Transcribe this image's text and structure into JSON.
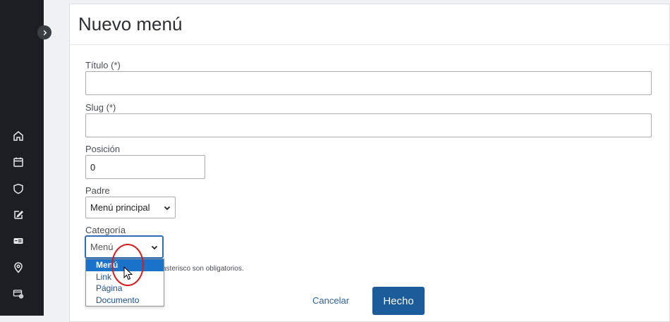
{
  "page": {
    "title": "Nuevo menú"
  },
  "form": {
    "titulo_label": "Título (*)",
    "titulo_value": "",
    "slug_label": "Slug (*)",
    "slug_value": "",
    "posicion_label": "Posición",
    "posicion_value": "0",
    "padre_label": "Padre",
    "padre_value": "Menú principal",
    "categoria_label": "Categoría",
    "categoria_value": "Menú",
    "categoria_options": [
      "Menú",
      "Link",
      "Página",
      "Documento"
    ],
    "required_note": "asterisco son obligatorios."
  },
  "actions": {
    "cancel_label": "Cancelar",
    "done_label": "Hecho"
  },
  "sidebar": {
    "icons": [
      "home-icon",
      "calendar-icon",
      "shield-icon",
      "edit-icon",
      "ticket-icon",
      "location-icon",
      "settings-card-icon"
    ]
  },
  "colors": {
    "sidebar_bg": "#1b1f23",
    "primary": "#1d5c9a",
    "highlight": "#1a73c8",
    "annotation_red": "#d81b1b"
  }
}
